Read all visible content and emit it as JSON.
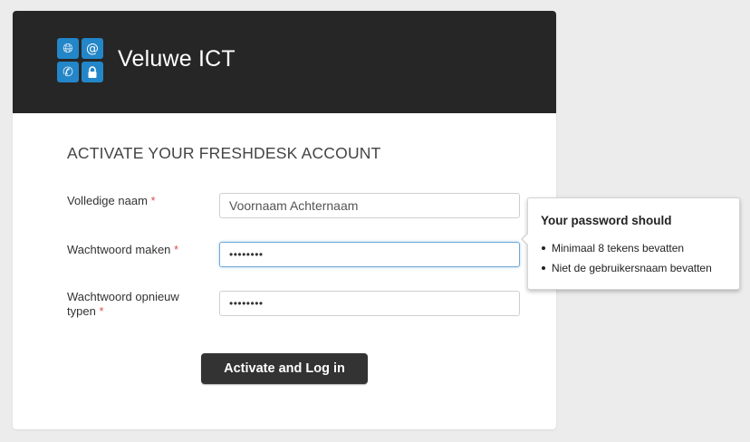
{
  "header": {
    "brand": "Veluwe ICT"
  },
  "form": {
    "title": "ACTIVATE YOUR FRESHDESK ACCOUNT",
    "fullname": {
      "label": "Volledige naam",
      "required": "*",
      "value": "Voornaam Achternaam"
    },
    "password": {
      "label": "Wachtwoord maken",
      "required": "*",
      "value": "••••••••"
    },
    "password_repeat": {
      "label_line1": "Wachtwoord opnieuw",
      "label_line2": "typen",
      "required": "*",
      "value": "••••••••"
    },
    "submit_label": "Activate and Log in"
  },
  "tooltip": {
    "title": "Your password should",
    "rules": [
      "Minimaal 8 tekens bevatten",
      "Niet de gebruikersnaam bevatten"
    ]
  },
  "colors": {
    "header_bg": "#262626",
    "accent": "#2386c8",
    "required": "#d9534f",
    "button": "#333333"
  }
}
